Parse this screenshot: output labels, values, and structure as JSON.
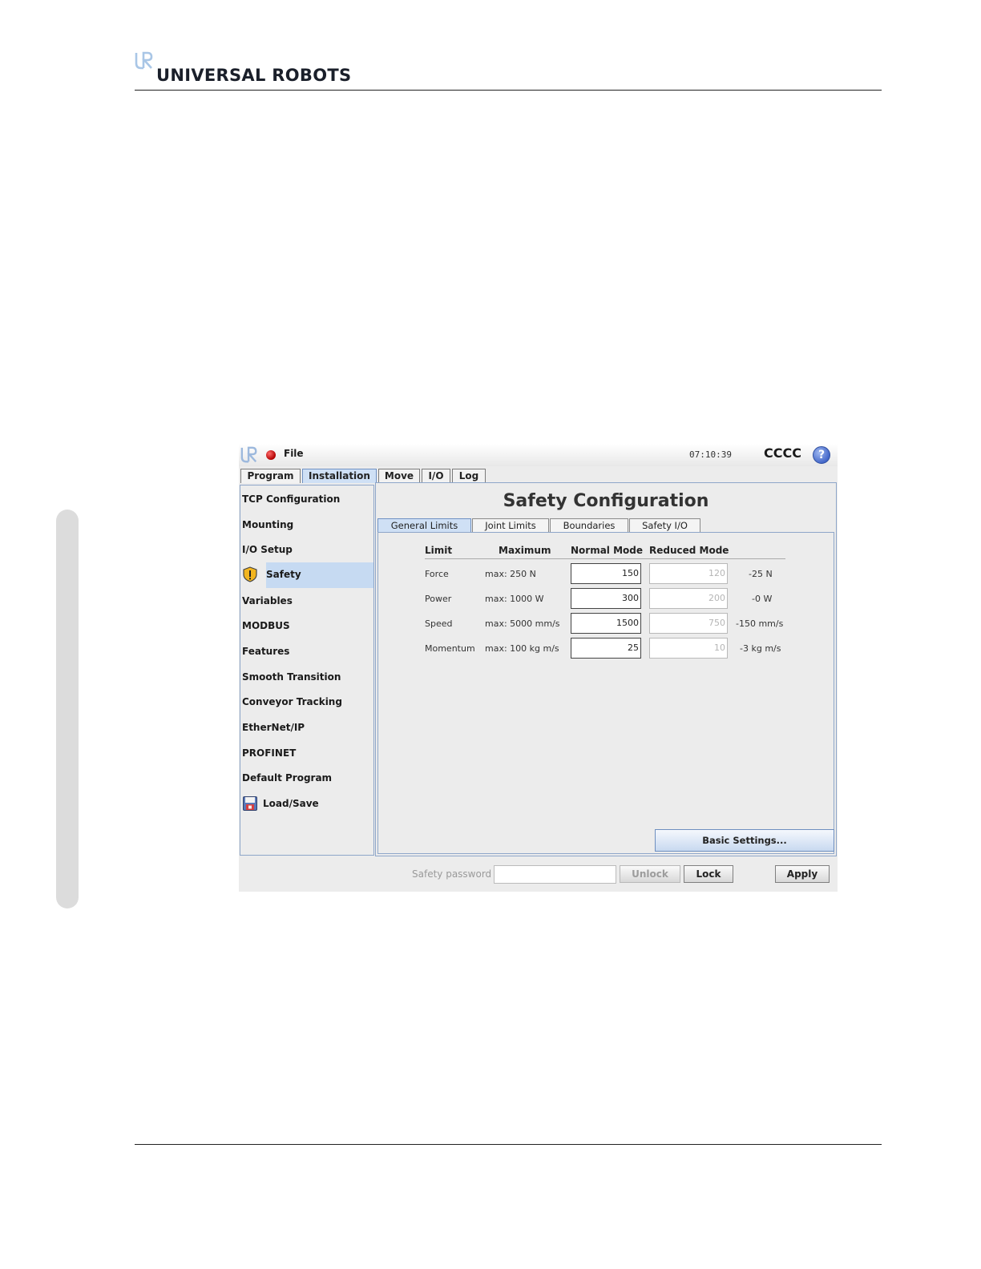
{
  "document": {
    "brand_name": "UNIVERSAL ROBOTS",
    "brand_logo_icon": "ur-logo-icon"
  },
  "app": {
    "menu": {
      "file_label": "File"
    },
    "status_light_color": "#cc0000",
    "clock": "07:10:39",
    "robot_name": "CCCC",
    "help_glyph": "?",
    "main_tabs": [
      {
        "label": "Program",
        "active": false
      },
      {
        "label": "Installation",
        "active": true
      },
      {
        "label": "Move",
        "active": false
      },
      {
        "label": "I/O",
        "active": false
      },
      {
        "label": "Log",
        "active": false
      }
    ],
    "nav": [
      {
        "label": "TCP Configuration"
      },
      {
        "label": "Mounting"
      },
      {
        "label": "I/O Setup"
      },
      {
        "label": "Safety",
        "icon": "warning-shield-icon",
        "active": true
      },
      {
        "label": "Variables"
      },
      {
        "label": "MODBUS"
      },
      {
        "label": "Features"
      },
      {
        "label": "Smooth Transition"
      },
      {
        "label": "Conveyor Tracking"
      },
      {
        "label": "EtherNet/IP"
      },
      {
        "label": "PROFINET"
      },
      {
        "label": "Default Program"
      },
      {
        "label": "Load/Save",
        "icon": "floppy-disk-icon"
      }
    ],
    "page_title": "Safety Configuration",
    "sub_tabs": [
      {
        "label": "General Limits",
        "active": true
      },
      {
        "label": "Joint Limits",
        "active": false
      },
      {
        "label": "Boundaries",
        "active": false
      },
      {
        "label": "Safety I/O",
        "active": false
      }
    ],
    "table": {
      "headers": [
        "Limit",
        "Maximum",
        "Normal Mode",
        "Reduced Mode"
      ],
      "rows": [
        {
          "limit": "Force",
          "maximum": "max: 250 N",
          "normal": "150",
          "reduced": "120",
          "diff": "-25 N"
        },
        {
          "limit": "Power",
          "maximum": "max: 1000 W",
          "normal": "300",
          "reduced": "200",
          "diff": "-0 W"
        },
        {
          "limit": "Speed",
          "maximum": "max: 5000 mm/s",
          "normal": "1500",
          "reduced": "750",
          "diff": "-150 mm/s"
        },
        {
          "limit": "Momentum",
          "maximum": "max: 100 kg m/s",
          "normal": "25",
          "reduced": "10",
          "diff": "-3 kg m/s"
        }
      ]
    },
    "basic_settings_label": "Basic Settings...",
    "bottom": {
      "password_label": "Safety password",
      "password_value": "",
      "unlock_label": "Unlock",
      "lock_label": "Lock",
      "apply_label": "Apply"
    },
    "colors": {
      "accent": "#c6daf2",
      "panel_border": "#8ea6c9",
      "background": "#ececec"
    }
  }
}
